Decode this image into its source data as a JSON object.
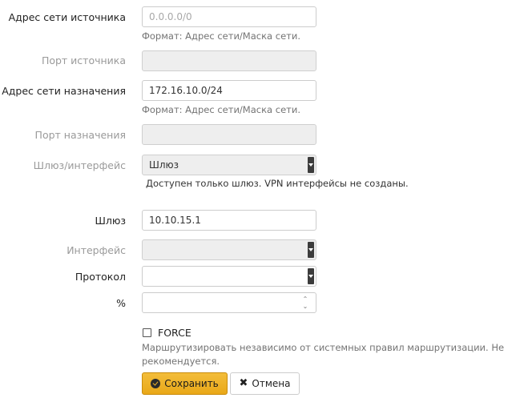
{
  "form": {
    "source_network": {
      "label": "Адрес сети источника",
      "placeholder": "0.0.0.0/0",
      "value": "",
      "help": "Формат: Адрес сети/Маска сети."
    },
    "source_port": {
      "label": "Порт источника",
      "value": ""
    },
    "dest_network": {
      "label": "Адрес сети назначения",
      "value": "172.16.10.0/24",
      "help": "Формат: Адрес сети/Маска сети."
    },
    "dest_port": {
      "label": "Порт назначения",
      "value": ""
    },
    "gateway_interface": {
      "label": "Шлюз/интерфейс",
      "selected": "Шлюз",
      "note": "Доступен только шлюз. VPN интерфейсы не созданы."
    },
    "gateway": {
      "label": "Шлюз",
      "value": "10.10.15.1"
    },
    "interface": {
      "label": "Интерфейс",
      "selected": ""
    },
    "protocol": {
      "label": "Протокол",
      "selected": ""
    },
    "percent": {
      "label": "%",
      "value": ""
    },
    "force": {
      "label": "FORCE",
      "checked": false,
      "help": "Маршрутизировать независимо от системных правил маршрутизации. Не рекомендуется."
    }
  },
  "buttons": {
    "save_label": "Сохранить",
    "cancel_label": "Отмена"
  },
  "icons": {
    "save": "ok-circle-icon",
    "cancel": "close-icon"
  },
  "colors": {
    "save_button": "#f0b429",
    "disabled_field": "#eeeeee",
    "help_text": "#737373",
    "dim_label": "#9a9a9a"
  }
}
